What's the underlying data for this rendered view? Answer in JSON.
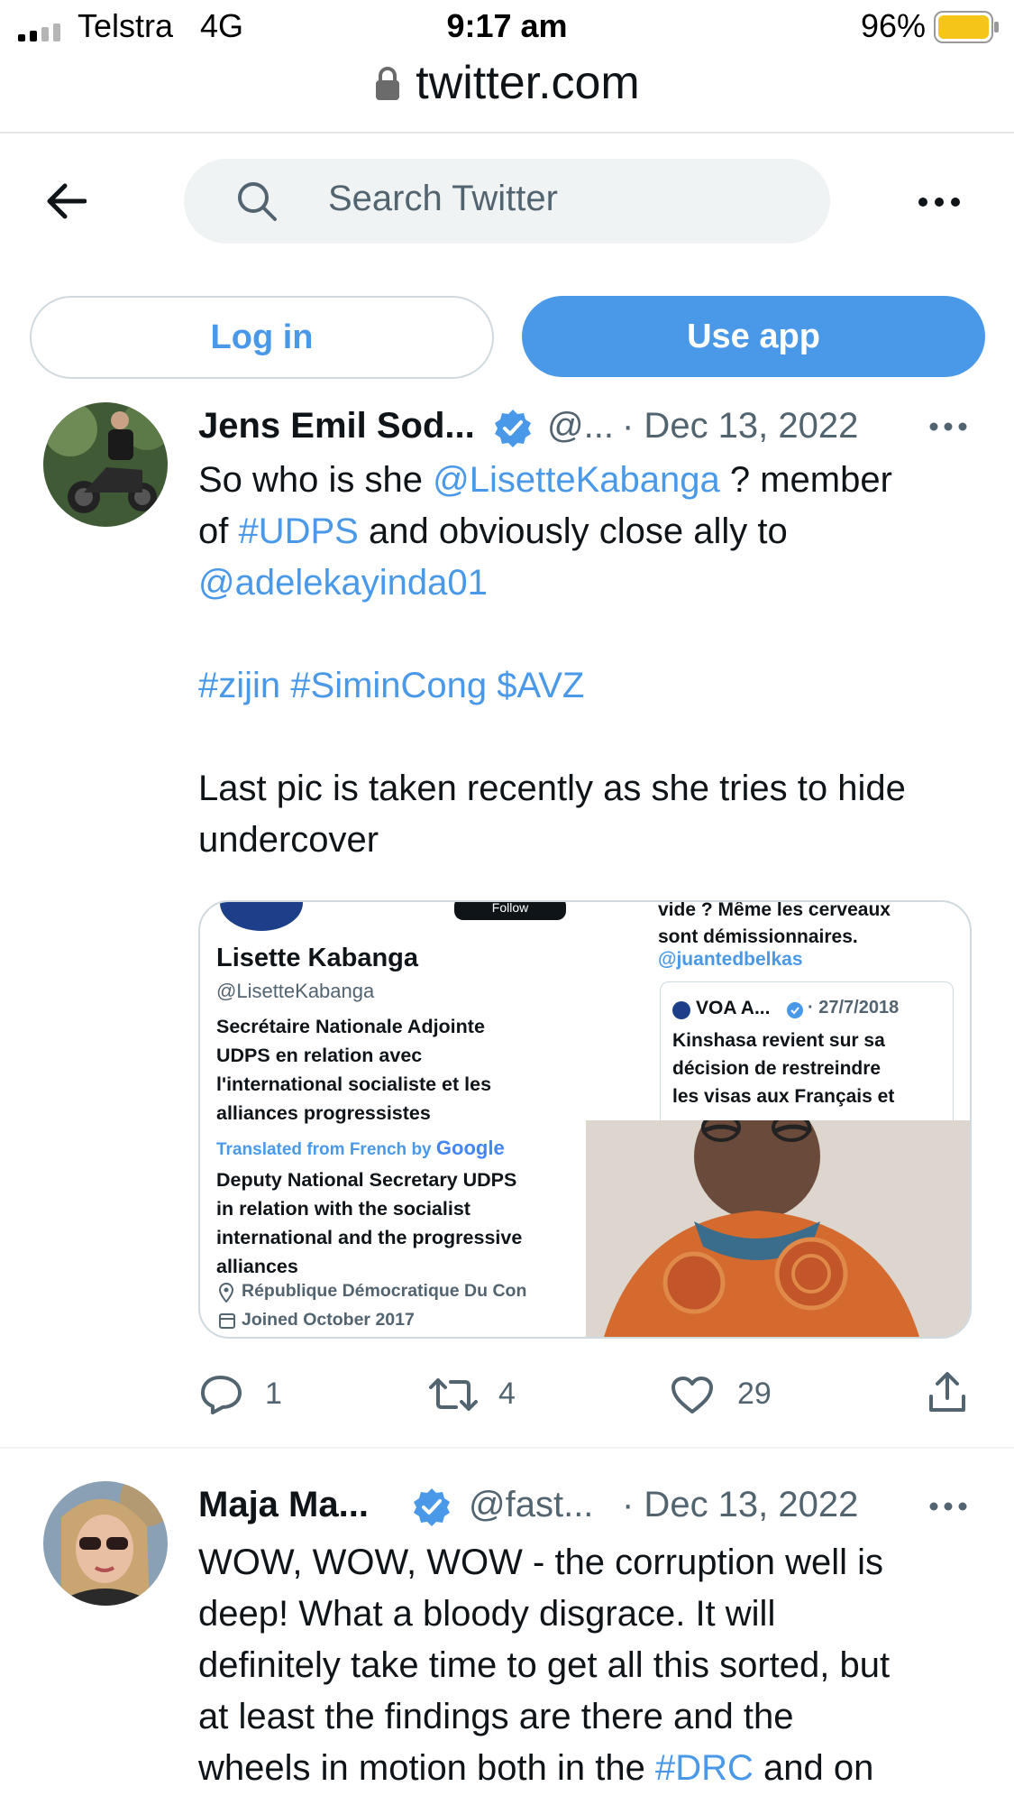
{
  "status_bar": {
    "carrier": "Telstra",
    "network": "4G",
    "time": "9:17 am",
    "battery": "96%"
  },
  "browser": {
    "url": "twitter.com"
  },
  "header": {
    "search_placeholder": "Search Twitter"
  },
  "auth": {
    "login_label": "Log in",
    "use_app_label": "Use app"
  },
  "tweets": [
    {
      "name": "Jens Emil Sod...",
      "handle": "@...",
      "date": "· Dec 13, 2022",
      "lines": {
        "l1_pre": "So who is she ",
        "l1_link": "@LisetteKabanga",
        "l1_post": " ? member",
        "l2_pre": "of ",
        "l2_link": "#UDPS",
        "l2_post": " and obviously close ally to",
        "l3_link": "@adelekayinda01",
        "l4_tag1": "#zijin",
        "l4_tag2": "#SiminCong",
        "l4_tag3": "$AVZ",
        "l5": "Last pic is taken recently as she tries to hide",
        "l6": "undercover"
      },
      "media": {
        "follow": "Follow",
        "profile_name": "Lisette Kabanga",
        "profile_handle": "@LisetteKabanga",
        "bio_fr_1": "Secrétaire Nationale Adjointe",
        "bio_fr_2": "UDPS en relation avec",
        "bio_fr_3": "l'international socialiste et les",
        "bio_fr_4": "alliances progressistes",
        "translated": "Translated from French by",
        "google": "Google",
        "bio_en_1": "Deputy National Secretary UDPS",
        "bio_en_2": "in relation with the socialist",
        "bio_en_3": "international and the progressive",
        "bio_en_4": "alliances",
        "location": "République Démocratique Du Con",
        "joined": "Joined October 2017",
        "quote_top_1": "vide ? Même les cerveaux",
        "quote_top_2": "sont démissionnaires.",
        "quote_handle": "@juantedbelkas",
        "quote_name": "VOA A...",
        "quote_date": "· 27/7/2018",
        "quote_line1": "Kinshasa revient sur sa",
        "quote_line2": "décision de restreindre",
        "quote_line3": "les visas aux Français et"
      },
      "replies": "1",
      "retweets": "4",
      "likes": "29"
    },
    {
      "name": "Maja Ma...",
      "handle": "@fast...",
      "date": "· Dec 13, 2022",
      "lines": {
        "l1": "WOW, WOW, WOW - the corruption well is",
        "l2": "deep! What a bloody disgrace. It will",
        "l3": "definitely take time to get all this sorted, but",
        "l4": "at least the findings are there and the",
        "l5_pre": "wheels in motion both in the ",
        "l5_link": "#DRC",
        "l5_post": " and on"
      }
    }
  ],
  "colors": {
    "accent": "#4a99e9",
    "text": "#0f1419",
    "muted": "#536471",
    "battery": "#f5c518"
  },
  "icons": [
    "signal-icon",
    "lock-icon",
    "battery-icon",
    "back-arrow-icon",
    "search-icon",
    "more-icon",
    "verified-icon",
    "reply-icon",
    "retweet-icon",
    "like-icon",
    "share-icon",
    "location-icon",
    "calendar-icon"
  ]
}
